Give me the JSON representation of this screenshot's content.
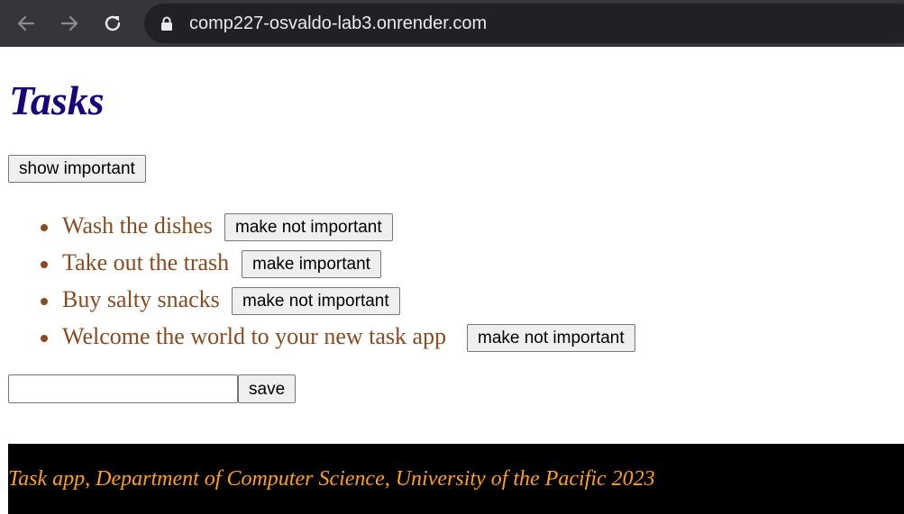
{
  "browser": {
    "url": "comp227-osvaldo-lab3.onrender.com"
  },
  "page": {
    "title": "Tasks",
    "show_button_label": "show important",
    "tasks": [
      {
        "text": "Wash the dishes",
        "button_label": "make not important"
      },
      {
        "text": "Take out the trash",
        "button_label": "make important"
      },
      {
        "text": "Buy salty snacks",
        "button_label": "make not important"
      },
      {
        "text": "Welcome the world to your new task app",
        "button_label": "make not important"
      }
    ],
    "new_task_input": {
      "value": "",
      "placeholder": ""
    },
    "save_label": "save",
    "footer": "Task app, Department of Computer Science, University of the Pacific 2023"
  },
  "colors": {
    "title": "#1a007a",
    "task_text": "#8a4b1e",
    "footer_bg": "#000000",
    "footer_text": "#ff9f1c"
  },
  "icons": [
    "back-arrow-icon",
    "forward-arrow-icon",
    "reload-icon",
    "lock-icon"
  ]
}
